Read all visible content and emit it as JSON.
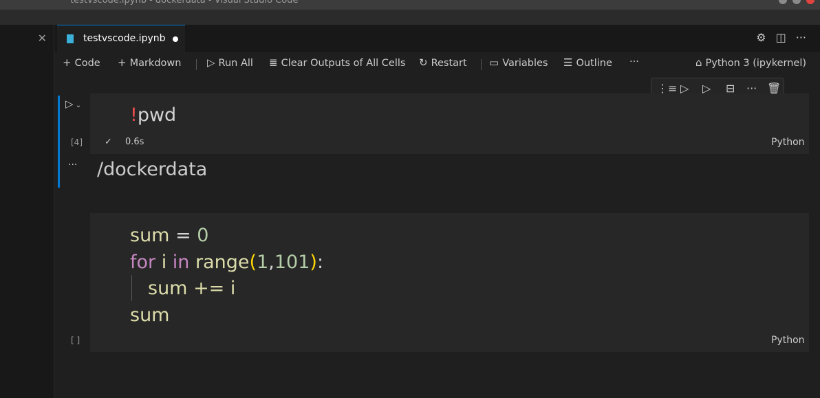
{
  "titlebar": {
    "text": "testvscode.ipynb - dockerdata - Visual Studio Code"
  },
  "sidebar": {
    "close_glyph": "✕"
  },
  "tab": {
    "name": "testvscode.ipynb",
    "icon": "notebook-icon",
    "dirty": true
  },
  "tab_actions": [
    {
      "name": "settings-gear-icon",
      "glyph": "⚙"
    },
    {
      "name": "split-editor-icon",
      "glyph": "◫"
    },
    {
      "name": "more-actions-icon",
      "glyph": "···"
    }
  ],
  "toolbar": {
    "code_label": "Code",
    "markdown_label": "Markdown",
    "run_all_label": "Run All",
    "clear_label": "Clear Outputs of All Cells",
    "restart_label": "Restart",
    "variables_label": "Variables",
    "outline_label": "Outline",
    "more_label": "···",
    "kernel_label": "Python 3 (ipykernel)"
  },
  "cell_toolbar": [
    {
      "name": "execute-above-icon",
      "glyph": "⋮≡"
    },
    {
      "name": "execute-cell-and-above-icon",
      "glyph": "▷"
    },
    {
      "name": "execute-cell-and-below-icon",
      "glyph": "▷"
    },
    {
      "name": "split-cell-icon",
      "glyph": "⊟"
    },
    {
      "name": "cell-more-icon",
      "glyph": "···"
    },
    {
      "name": "delete-cell-icon",
      "glyph": "🗑"
    }
  ],
  "cell1": {
    "bang": "!",
    "code": "pwd",
    "exec_count": "[4]",
    "check": "✓",
    "duration": "0.6s",
    "language": "Python",
    "output": "/dockerdata",
    "output_more": "···"
  },
  "cell2": {
    "line1": {
      "a": "sum",
      "b": " = ",
      "c": "0"
    },
    "line2": {
      "kw_for": "for",
      "var": " i ",
      "kw_in": "in",
      "fn": " range",
      "lp": "(",
      "n1": "1",
      "comma": ",",
      "n2": "101",
      "rp": ")",
      "colon": ":"
    },
    "line3": "sum += i",
    "line4": "sum",
    "exec_count": "[ ]",
    "language": "Python"
  }
}
